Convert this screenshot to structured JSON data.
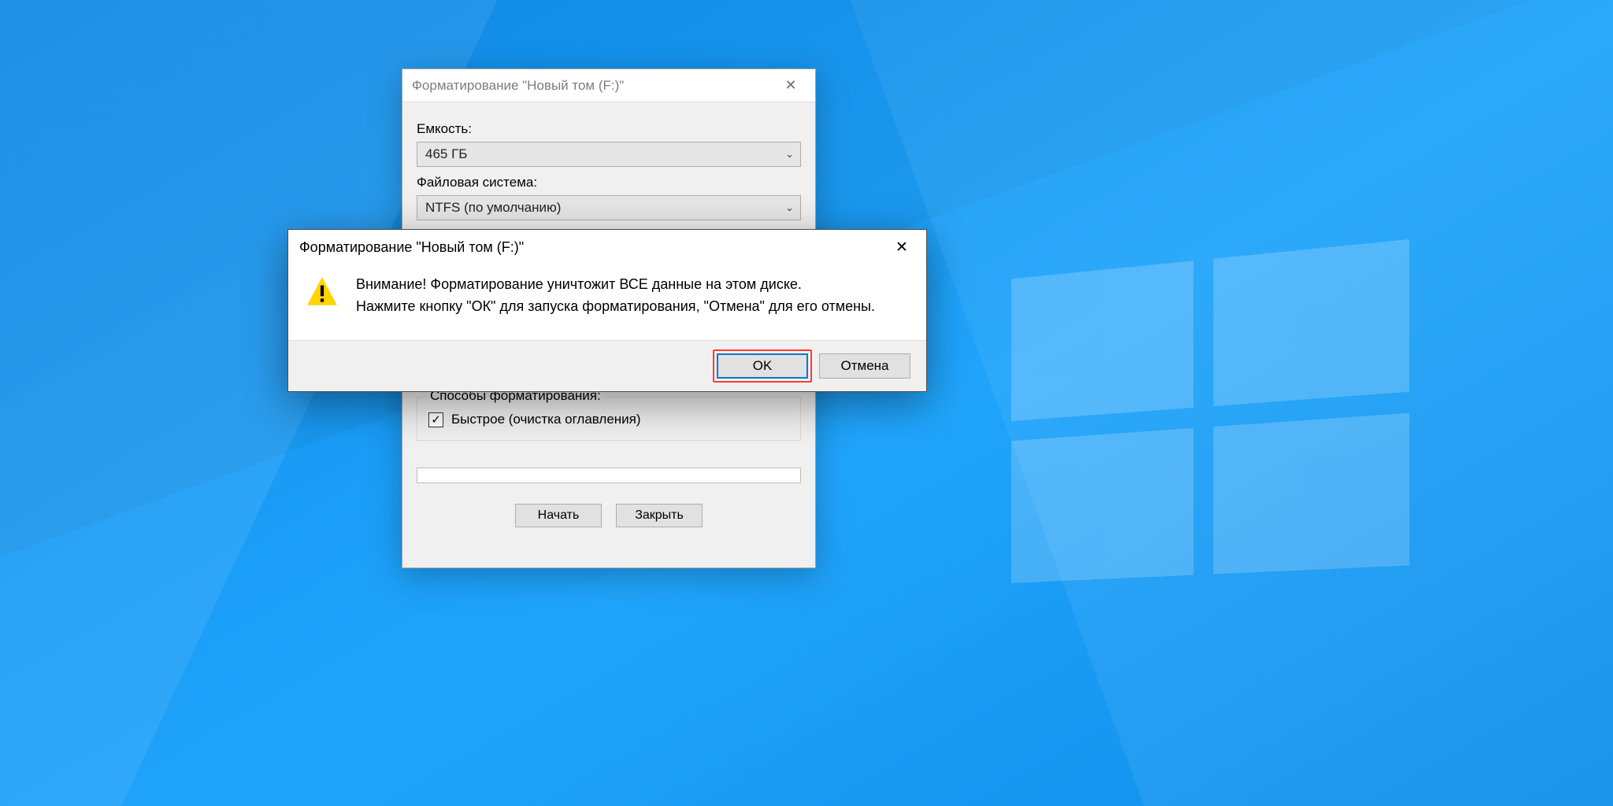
{
  "format_dialog": {
    "title": "Форматирование \"Новый том (F:)\"",
    "capacity_label": "Емкость:",
    "capacity_value": "465 ГБ",
    "filesystem_label": "Файловая система:",
    "filesystem_value": "NTFS (по умолчанию)",
    "options_legend": "Способы форматирования:",
    "quick_format_label": "Быстрое (очистка оглавления)",
    "quick_format_checked": true,
    "start_button": "Начать",
    "close_button": "Закрыть"
  },
  "messagebox": {
    "title": "Форматирование \"Новый том (F:)\"",
    "line1": "Внимание! Форматирование уничтожит ВСЕ данные на этом диске.",
    "line2": "Нажмите кнопку \"ОК\" для запуска форматирования, \"Отмена\" для его отмены.",
    "ok": "OK",
    "cancel": "Отмена"
  },
  "icons": {
    "close": "✕",
    "chevron_down": "⌄",
    "checkmark": "✓"
  }
}
